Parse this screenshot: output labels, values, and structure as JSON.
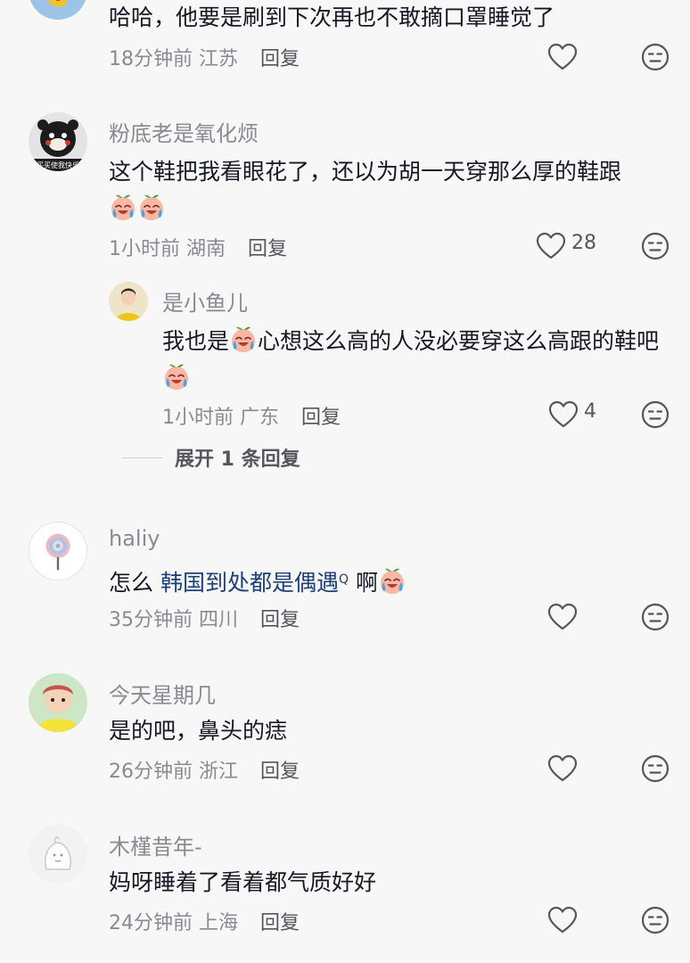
{
  "comments": [
    {
      "id": "c0",
      "text": "哈哈，他要是刷到下次再也不敢摘口罩睡觉了",
      "time": "18分钟前",
      "location": "江苏",
      "reply": "回复",
      "likes": ""
    },
    {
      "id": "c1",
      "username": "粉底老是氧化烦",
      "avatar_caption": "买买使我快乐",
      "text": "这个鞋把我看眼花了，还以为胡一天穿那么厚的鞋跟",
      "time": "1小时前",
      "location": "湖南",
      "reply": "回复",
      "likes": "28"
    },
    {
      "id": "r1",
      "username": "是小鱼儿",
      "text_a": "我也是",
      "text_b": "心想这么高的人没必要穿这么高跟的鞋吧",
      "time": "1小时前",
      "location": "广东",
      "reply": "回复",
      "likes": "4"
    },
    {
      "id": "c2",
      "username": "haliy",
      "text_a": "怎么 ",
      "link": "韩国到处都是偶遇",
      "link_sup": "Q",
      "text_b": " 啊",
      "time": "35分钟前",
      "location": "四川",
      "reply": "回复",
      "likes": ""
    },
    {
      "id": "c3",
      "username": "今天星期几",
      "text": "是的吧，鼻头的痣",
      "time": "26分钟前",
      "location": "浙江",
      "reply": "回复",
      "likes": ""
    },
    {
      "id": "c4",
      "username": "木槿昔年-",
      "text": "妈呀睡着了看着都气质好好",
      "time": "24分钟前",
      "location": "上海",
      "reply": "回复",
      "likes": ""
    }
  ],
  "expand_replies": "展开 1 条回复",
  "icons": {
    "like": "heart-outline-icon",
    "dislike": "dislike-face-icon",
    "emoji": "crying-laughing-peach-emoji"
  },
  "colors": {
    "background": "#f7f7f7",
    "text": "#161823",
    "secondary": "#8a8b91",
    "link": "#1d3f7a"
  }
}
